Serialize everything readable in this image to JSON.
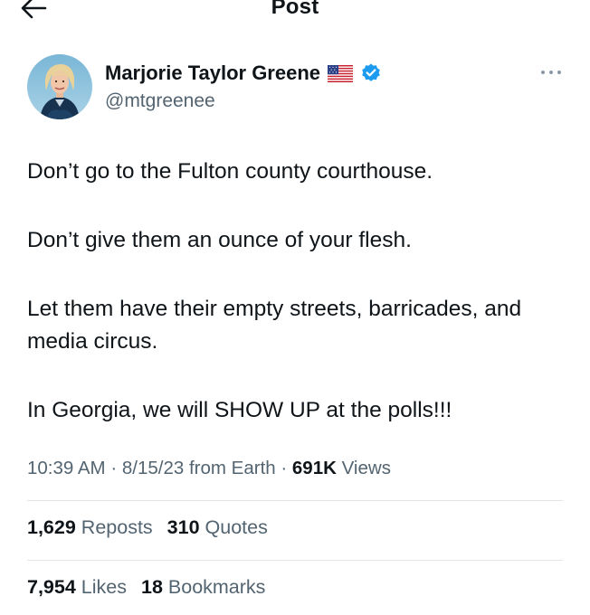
{
  "header": {
    "title": "Post",
    "back_icon": "arrow-left-icon"
  },
  "author": {
    "name": "Marjorie Taylor Greene",
    "handle": "@mtgreenee",
    "flag_icon": "us-flag-icon",
    "verified_icon": "verified-badge-icon",
    "verified_color": "#1d9bf0"
  },
  "post": {
    "paragraphs": [
      "Don’t go to the Fulton county courthouse.",
      "Don’t give them an ounce of your flesh.",
      "Let them have their empty streets, barricades, and media circus.",
      "In Georgia, we will SHOW UP at the polls!!!"
    ]
  },
  "meta": {
    "time": "10:39 AM",
    "separator": "·",
    "date": "8/15/23",
    "source": "from Earth",
    "views_count": "691K",
    "views_label": "Views"
  },
  "stats": {
    "reposts_count": "1,629",
    "reposts_label": "Reposts",
    "quotes_count": "310",
    "quotes_label": "Quotes",
    "likes_count": "7,954",
    "likes_label": "Likes",
    "bookmarks_count": "18",
    "bookmarks_label": "Bookmarks"
  },
  "colors": {
    "text_primary": "#0f1419",
    "text_secondary": "#536471",
    "divider": "#e3e6e9"
  }
}
